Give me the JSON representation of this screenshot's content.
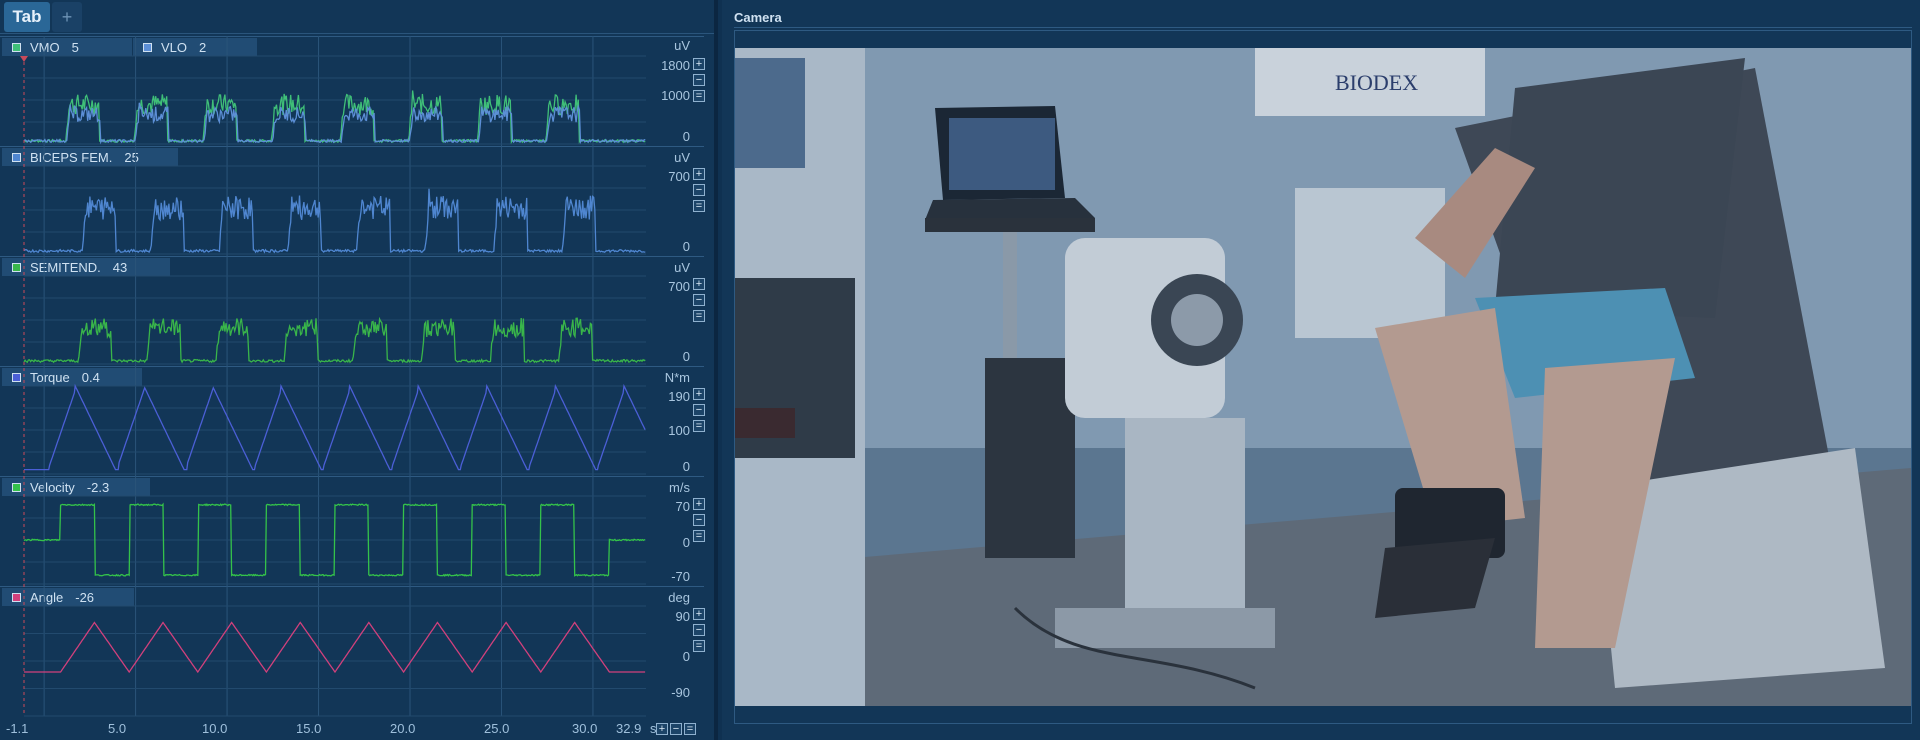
{
  "tabs": {
    "active_label": "Tab",
    "add_label": "+"
  },
  "channels": [
    {
      "name": "VMO",
      "value": "5",
      "unit": "uV",
      "scale": [
        "1800",
        "1000",
        "0"
      ],
      "color": "#3fbf78",
      "second_name": "VLO",
      "second_value": "2",
      "second_color": "#5c8fd6"
    },
    {
      "name": "BICEPS FEM.",
      "value": "25",
      "unit": "uV",
      "scale": [
        "700",
        "0"
      ],
      "color": "#4f86d0"
    },
    {
      "name": "SEMITEND.",
      "value": "43",
      "unit": "uV",
      "scale": [
        "700",
        "0"
      ],
      "color": "#39b54a"
    },
    {
      "name": "Torque",
      "value": "0.4",
      "unit": "N*m",
      "scale": [
        "190",
        "100",
        "0"
      ],
      "color": "#4b5fd6"
    },
    {
      "name": "Velocity",
      "value": "-2.3",
      "unit": "m/s",
      "scale": [
        "70",
        "0",
        "-70"
      ],
      "color": "#34c24a"
    },
    {
      "name": "Angle",
      "value": "-26",
      "unit": "deg",
      "scale": [
        "90",
        "0",
        "-90"
      ],
      "color": "#d1407c"
    }
  ],
  "x_axis": {
    "ticks": [
      "-1.1",
      "5.0",
      "10.0",
      "15.0",
      "20.0",
      "25.0",
      "30.0"
    ],
    "end_label": "32.9",
    "unit": "s"
  },
  "camera": {
    "title": "Camera",
    "scene": {
      "poster_text": "BIODEX"
    }
  },
  "icons": {
    "plus": "plus-icon",
    "minus": "minus-icon",
    "equals": "fit-icon",
    "marker": "cursor-marker-icon"
  }
}
